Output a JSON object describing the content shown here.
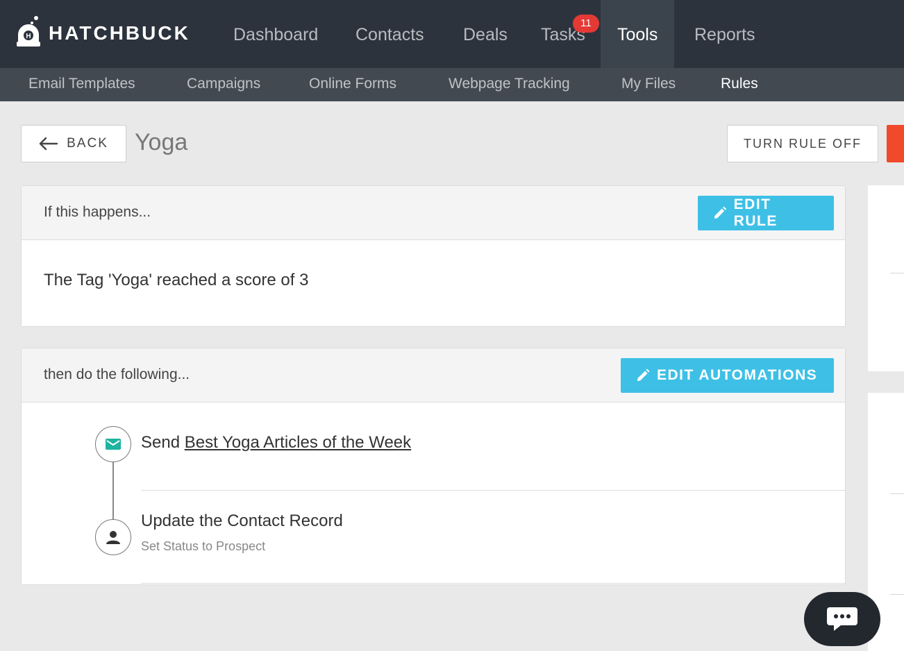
{
  "brand": {
    "name": "HATCHBUCK",
    "icon": "hatchbuck-logo-icon"
  },
  "colors": {
    "nav_bg": "#2d333c",
    "subnav_bg": "#424951",
    "accent": "#3ec0e6",
    "badge": "#e53935",
    "danger": "#f04a2a"
  },
  "nav": {
    "items": [
      {
        "label": "Dashboard"
      },
      {
        "label": "Contacts"
      },
      {
        "label": "Deals"
      },
      {
        "label": "Tasks",
        "badge": "11"
      },
      {
        "label": "Tools"
      },
      {
        "label": "Reports"
      }
    ],
    "active": "Tools"
  },
  "subnav": {
    "items": [
      {
        "label": "Email Templates"
      },
      {
        "label": "Campaigns"
      },
      {
        "label": "Online Forms"
      },
      {
        "label": "Webpage Tracking"
      },
      {
        "label": "My Files"
      },
      {
        "label": "Rules"
      }
    ],
    "active": "Rules"
  },
  "header": {
    "back_label": "BACK",
    "title": "Yoga",
    "turn_off_label": "TURN RULE OFF"
  },
  "trigger_card": {
    "heading": "If this happens...",
    "edit_label": "EDIT RULE",
    "rule_text": "The Tag 'Yoga' reached a score of 3"
  },
  "actions_card": {
    "heading": "then do the following...",
    "edit_label": "EDIT AUTOMATIONS",
    "steps": [
      {
        "icon": "envelope-icon",
        "prefix": "Send ",
        "link": "Best Yoga Articles of the Week"
      },
      {
        "icon": "person-icon",
        "title": "Update the Contact Record",
        "subtitle": "Set Status to Prospect"
      }
    ]
  },
  "chat": {
    "icon": "chat-bubble-icon"
  }
}
